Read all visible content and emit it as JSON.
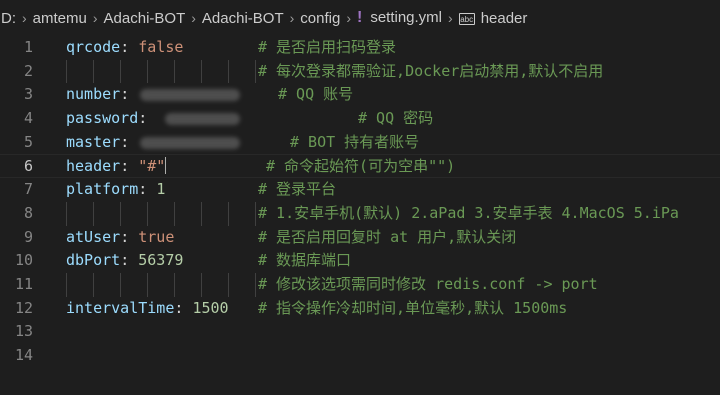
{
  "breadcrumb": {
    "items": [
      "D:",
      "amtemu",
      "Adachi-BOT",
      "Adachi-BOT",
      "config"
    ],
    "file": "setting.yml",
    "file_icon": "!",
    "symbol": "header",
    "symbol_icon": "abc"
  },
  "lines": [
    {
      "n": "1",
      "key": "qrcode",
      "sep": ": ",
      "value": "false",
      "vtype": "str",
      "comment": "# 是否启用扫码登录"
    },
    {
      "n": "2",
      "key": "",
      "sep": "",
      "value": "",
      "vtype": "",
      "comment": "# 每次登录都需验证,Docker启动禁用,默认不启用"
    },
    {
      "n": "3",
      "key": "number",
      "sep": ":",
      "value": "",
      "vtype": "",
      "comment": "# QQ 账号"
    },
    {
      "n": "4",
      "key": "password",
      "sep": ":",
      "value": "",
      "vtype": "",
      "comment": "# QQ 密码"
    },
    {
      "n": "5",
      "key": "master",
      "sep": ": ",
      "value": "",
      "vtype": "",
      "comment": "# BOT 持有者账号"
    },
    {
      "n": "6",
      "key": "header",
      "sep": ": ",
      "value": "\"#\"",
      "vtype": "str",
      "comment": "# 命令起始符(可为空串\"\")"
    },
    {
      "n": "7",
      "key": "platform",
      "sep": ": ",
      "value": "1",
      "vtype": "num",
      "comment": "# 登录平台"
    },
    {
      "n": "8",
      "key": "",
      "sep": "",
      "value": "",
      "vtype": "",
      "comment": "# 1.安卓手机(默认) 2.aPad 3.安卓手表 4.MacOS 5.iPa"
    },
    {
      "n": "9",
      "key": "atUser",
      "sep": ": ",
      "value": "true",
      "vtype": "str",
      "comment": "# 是否启用回复时 at 用户,默认关闭"
    },
    {
      "n": "10",
      "key": "dbPort",
      "sep": ": ",
      "value": "56379",
      "vtype": "num",
      "comment": "# 数据库端口"
    },
    {
      "n": "11",
      "key": "",
      "sep": "",
      "value": "",
      "vtype": "",
      "comment": "# 修改该选项需同时修改 redis.conf -> port"
    },
    {
      "n": "12",
      "key": "intervalTime",
      "sep": ": ",
      "value": "1500",
      "vtype": "num",
      "comment": "# 指令操作冷却时间,单位毫秒,默认 1500ms"
    },
    {
      "n": "13",
      "key": "",
      "sep": "",
      "value": "",
      "vtype": "",
      "comment": ""
    },
    {
      "n": "14",
      "key": "",
      "sep": "",
      "value": "",
      "vtype": "",
      "comment": ""
    }
  ],
  "current_line": "6",
  "colors": {
    "key": "#9cdcfe",
    "string": "#ce9178",
    "number": "#b5cea8",
    "comment": "#6a9955",
    "background": "#1e1e1e"
  }
}
